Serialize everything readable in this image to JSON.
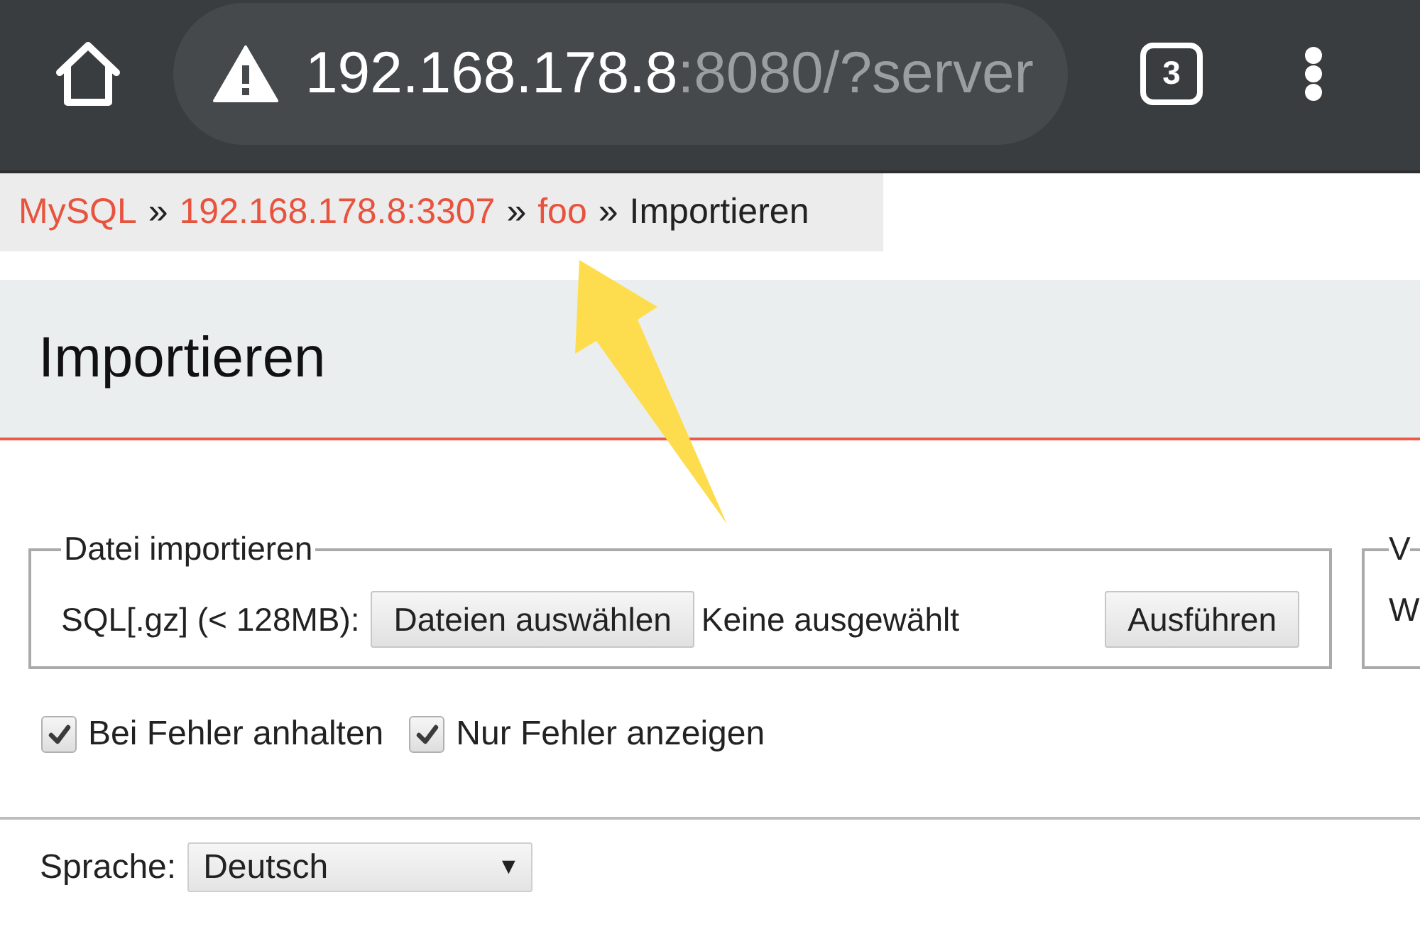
{
  "browser": {
    "url_host": "192.168.178.8",
    "url_rest": ":8080/?server",
    "tab_count": "3"
  },
  "breadcrumb": [
    {
      "label": "MySQL",
      "kind": "link"
    },
    {
      "separator": "»",
      "label": "192.168.178.8:3307",
      "kind": "link"
    },
    {
      "separator": "»",
      "label": "foo",
      "kind": "link"
    },
    {
      "separator": "»",
      "label": "Importieren",
      "kind": "current"
    }
  ],
  "heading": "Importieren",
  "highlight_arrow": true,
  "fieldsets": [
    {
      "kind": "file-import",
      "legend": "Datei importieren",
      "file_label": "SQL[.gz] (< 128MB):",
      "choose_button": "Dateien auswählen",
      "file_status": "Keine ausgewählt",
      "submit_button": "Ausführen"
    },
    {
      "kind": "partial",
      "legend": "V",
      "content": "W"
    }
  ],
  "options": [
    {
      "label": "Bei Fehler anhalten",
      "checked": true
    },
    {
      "label": "Nur Fehler anzeigen",
      "checked": true
    }
  ],
  "language": {
    "label": "Sprache:",
    "value": "Deutsch",
    "caret": "▼"
  }
}
